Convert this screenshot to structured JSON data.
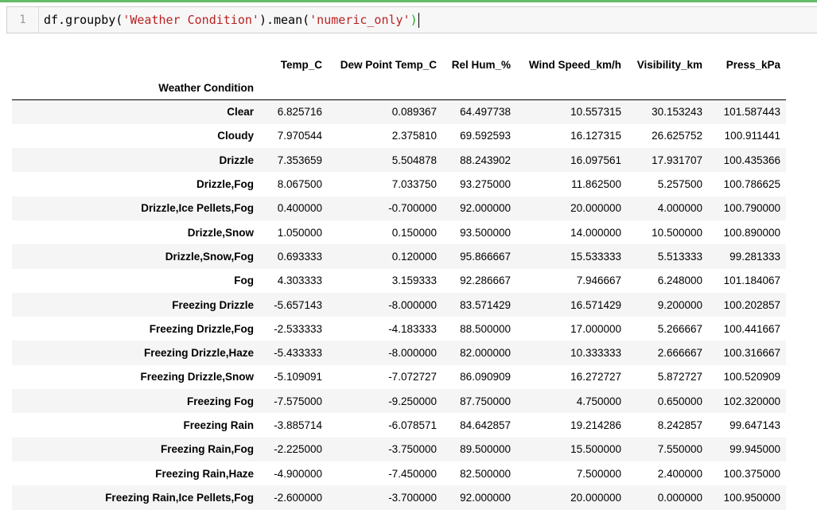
{
  "cell": {
    "line_number": "1",
    "code_prefix": "df.groupby(",
    "code_arg1": "'Weather Condition'",
    "code_mid": ").mean(",
    "code_arg2": "'numeric_only'",
    "code_suffix": ")"
  },
  "table": {
    "index_name": "Weather Condition",
    "columns": [
      "Temp_C",
      "Dew Point Temp_C",
      "Rel Hum_%",
      "Wind Speed_km/h",
      "Visibility_km",
      "Press_kPa"
    ],
    "rows": [
      {
        "label": "Clear",
        "values": [
          "6.825716",
          "0.089367",
          "64.497738",
          "10.557315",
          "30.153243",
          "101.587443"
        ]
      },
      {
        "label": "Cloudy",
        "values": [
          "7.970544",
          "2.375810",
          "69.592593",
          "16.127315",
          "26.625752",
          "100.911441"
        ]
      },
      {
        "label": "Drizzle",
        "values": [
          "7.353659",
          "5.504878",
          "88.243902",
          "16.097561",
          "17.931707",
          "100.435366"
        ]
      },
      {
        "label": "Drizzle,Fog",
        "values": [
          "8.067500",
          "7.033750",
          "93.275000",
          "11.862500",
          "5.257500",
          "100.786625"
        ]
      },
      {
        "label": "Drizzle,Ice Pellets,Fog",
        "values": [
          "0.400000",
          "-0.700000",
          "92.000000",
          "20.000000",
          "4.000000",
          "100.790000"
        ]
      },
      {
        "label": "Drizzle,Snow",
        "values": [
          "1.050000",
          "0.150000",
          "93.500000",
          "14.000000",
          "10.500000",
          "100.890000"
        ]
      },
      {
        "label": "Drizzle,Snow,Fog",
        "values": [
          "0.693333",
          "0.120000",
          "95.866667",
          "15.533333",
          "5.513333",
          "99.281333"
        ]
      },
      {
        "label": "Fog",
        "values": [
          "4.303333",
          "3.159333",
          "92.286667",
          "7.946667",
          "6.248000",
          "101.184067"
        ]
      },
      {
        "label": "Freezing Drizzle",
        "values": [
          "-5.657143",
          "-8.000000",
          "83.571429",
          "16.571429",
          "9.200000",
          "100.202857"
        ]
      },
      {
        "label": "Freezing Drizzle,Fog",
        "values": [
          "-2.533333",
          "-4.183333",
          "88.500000",
          "17.000000",
          "5.266667",
          "100.441667"
        ]
      },
      {
        "label": "Freezing Drizzle,Haze",
        "values": [
          "-5.433333",
          "-8.000000",
          "82.000000",
          "10.333333",
          "2.666667",
          "100.316667"
        ]
      },
      {
        "label": "Freezing Drizzle,Snow",
        "values": [
          "-5.109091",
          "-7.072727",
          "86.090909",
          "16.272727",
          "5.872727",
          "100.520909"
        ]
      },
      {
        "label": "Freezing Fog",
        "values": [
          "-7.575000",
          "-9.250000",
          "87.750000",
          "4.750000",
          "0.650000",
          "102.320000"
        ]
      },
      {
        "label": "Freezing Rain",
        "values": [
          "-3.885714",
          "-6.078571",
          "84.642857",
          "19.214286",
          "8.242857",
          "99.647143"
        ]
      },
      {
        "label": "Freezing Rain,Fog",
        "values": [
          "-2.225000",
          "-3.750000",
          "89.500000",
          "15.500000",
          "7.550000",
          "99.945000"
        ]
      },
      {
        "label": "Freezing Rain,Haze",
        "values": [
          "-4.900000",
          "-7.450000",
          "82.500000",
          "7.500000",
          "2.400000",
          "100.375000"
        ]
      },
      {
        "label": "Freezing Rain,Ice Pellets,Fog",
        "values": [
          "-2.600000",
          "-3.700000",
          "92.000000",
          "20.000000",
          "0.000000",
          "100.950000"
        ]
      }
    ]
  }
}
